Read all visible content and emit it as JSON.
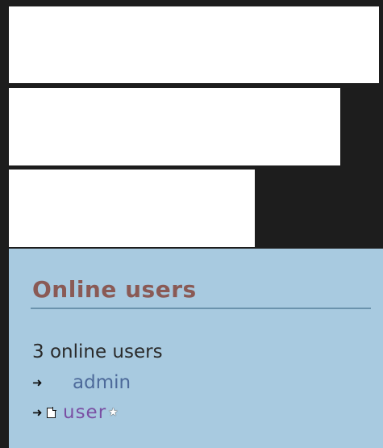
{
  "online_users": {
    "title": "Online users",
    "count_text": "3 online users",
    "users": [
      {
        "name": "admin",
        "icon": "arrow-right-icon"
      },
      {
        "name": "user",
        "icons": [
          "arrow-right-icon",
          "page-icon"
        ],
        "badge": "star-icon"
      }
    ]
  },
  "colors": {
    "background": "#1d1d1d",
    "panel_background": "#a8cae0",
    "title": "#8a5a55",
    "admin_link": "#4d6a9a",
    "user_link": "#7a4fa3"
  }
}
